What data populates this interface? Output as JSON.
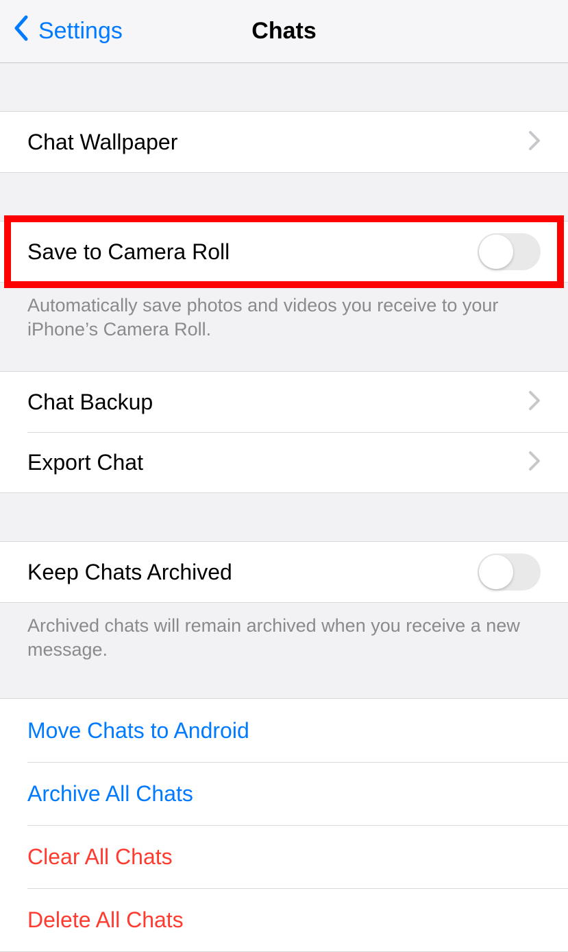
{
  "header": {
    "back_label": "Settings",
    "title": "Chats"
  },
  "rows": {
    "chat_wallpaper": "Chat Wallpaper",
    "save_to_camera_roll": "Save to Camera Roll",
    "save_to_camera_roll_footer": "Automatically save photos and videos you receive to your iPhone’s Camera Roll.",
    "chat_backup": "Chat Backup",
    "export_chat": "Export Chat",
    "keep_chats_archived": "Keep Chats Archived",
    "keep_chats_archived_footer": "Archived chats will remain archived when you receive a new message.",
    "move_chats_to_android": "Move Chats to Android",
    "archive_all_chats": "Archive All Chats",
    "clear_all_chats": "Clear All Chats",
    "delete_all_chats": "Delete All Chats"
  },
  "toggles": {
    "save_to_camera_roll": false,
    "keep_chats_archived": false
  },
  "colors": {
    "accent": "#007aff",
    "destructive": "#ff3b30",
    "highlight": "#ff0000"
  }
}
